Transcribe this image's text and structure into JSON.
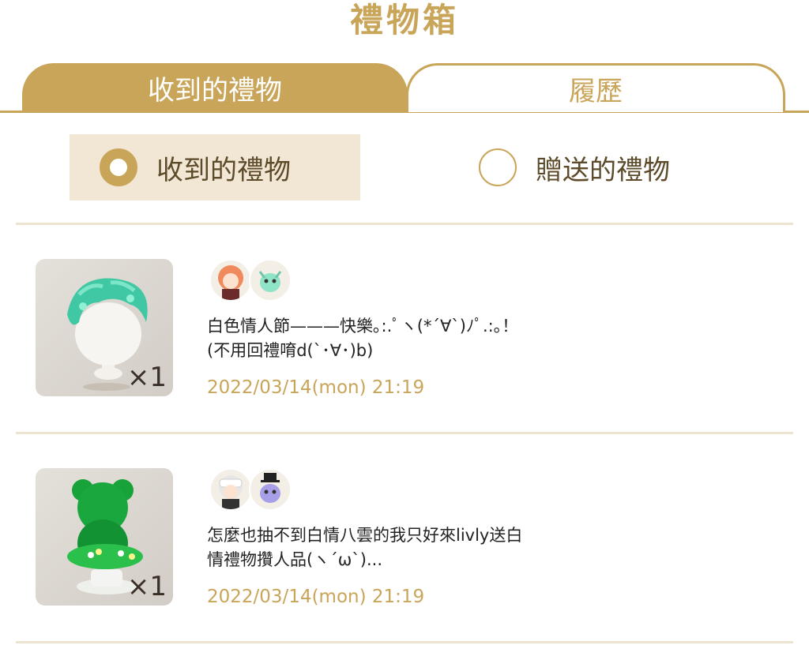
{
  "header": {
    "title": "禮物箱"
  },
  "tabs": [
    {
      "label": "收到的禮物",
      "active": true
    },
    {
      "label": "履歷",
      "active": false
    }
  ],
  "filter": {
    "options": [
      {
        "label": "收到的禮物",
        "selected": true
      },
      {
        "label": "贈送的禮物",
        "selected": false
      }
    ]
  },
  "gifts": [
    {
      "item_icon": "green-hair-icon",
      "quantity": "×1",
      "message_line1": "白色情人節———快樂｡:.ﾟヽ(*´∀`)ﾉﾟ.:｡！",
      "message_line2": "(不用回禮唷d(`･∀･)b)",
      "timestamp": "2022/03/14(mon) 21:19"
    },
    {
      "item_icon": "bear-topiary-icon",
      "quantity": "×1",
      "message_line1": "怎麼也抽不到白情八雲的我只好來livly送白",
      "message_line2": "情禮物攢人品(ヽ´ω`)...",
      "timestamp": "2022/03/14(mon) 21:19"
    }
  ],
  "colors": {
    "accent": "#c9a55a",
    "selected_bg": "#f1e7d4",
    "divider": "#ece3d0"
  }
}
